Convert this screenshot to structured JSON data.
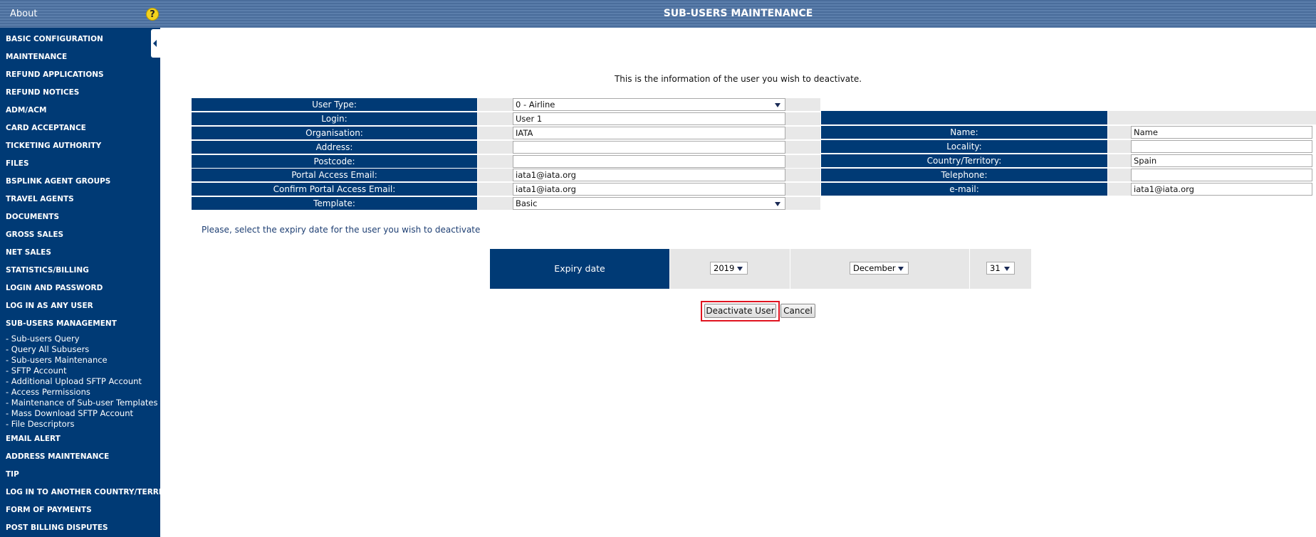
{
  "header": {
    "about": "About",
    "help": "?",
    "title": "SUB-USERS MAINTENANCE"
  },
  "sidebar": {
    "menu_top": [
      "BASIC CONFIGURATION",
      "MAINTENANCE",
      "REFUND APPLICATIONS",
      "REFUND NOTICES",
      "ADM/ACM",
      "CARD ACCEPTANCE",
      "TICKETING AUTHORITY",
      "FILES",
      "BSPLINK AGENT GROUPS",
      "TRAVEL AGENTS",
      "DOCUMENTS",
      "GROSS SALES",
      "NET SALES",
      "STATISTICS/BILLING",
      "LOGIN AND PASSWORD",
      "LOG IN AS ANY USER",
      "SUB-USERS MANAGEMENT"
    ],
    "submenu": [
      "- Sub-users Query",
      "- Query All Subusers",
      "- Sub-users Maintenance",
      "- SFTP Account",
      "- Additional Upload SFTP Account",
      "- Access Permissions",
      "- Maintenance of Sub-user Templates",
      "- Mass Download SFTP Account",
      "- File Descriptors"
    ],
    "menu_bottom": [
      "EMAIL ALERT",
      "ADDRESS MAINTENANCE",
      "TIP",
      "LOG IN TO ANOTHER COUNTRY/TERRITORY",
      "FORM OF PAYMENTS",
      "POST BILLING DISPUTES"
    ]
  },
  "intro": "This is the information of the user you wish to deactivate.",
  "form": {
    "left": [
      {
        "label": "User Type:",
        "value": "0 - Airline",
        "type": "select"
      },
      {
        "label": "Login:",
        "value": "User 1",
        "type": "input"
      },
      {
        "label": "Organisation:",
        "value": "IATA",
        "type": "input"
      },
      {
        "label": "Address:",
        "value": "",
        "type": "input"
      },
      {
        "label": "Postcode:",
        "value": "",
        "type": "input"
      },
      {
        "label": "Portal Access Email:",
        "value": "iata1@iata.org",
        "type": "input"
      },
      {
        "label": "Confirm Portal Access Email:",
        "value": "iata1@iata.org",
        "type": "input"
      },
      {
        "label": "Template:",
        "value": "Basic",
        "type": "select"
      }
    ],
    "right": [
      {
        "label": "Name:",
        "value": "Name"
      },
      {
        "label": "Locality:",
        "value": ""
      },
      {
        "label": "Country/Territory:",
        "value": "Spain"
      },
      {
        "label": "Telephone:",
        "value": ""
      },
      {
        "label": "e-mail:",
        "value": "iata1@iata.org"
      }
    ]
  },
  "note": "Please, select the expiry date for the user you wish to deactivate",
  "expiry": {
    "label": "Expiry date",
    "year": "2019",
    "month": "December",
    "day": "31"
  },
  "buttons": {
    "deactivate": "Deactivate User",
    "cancel": "Cancel"
  },
  "colors": {
    "navy": "#003a75",
    "highlight": "#e0131f"
  }
}
